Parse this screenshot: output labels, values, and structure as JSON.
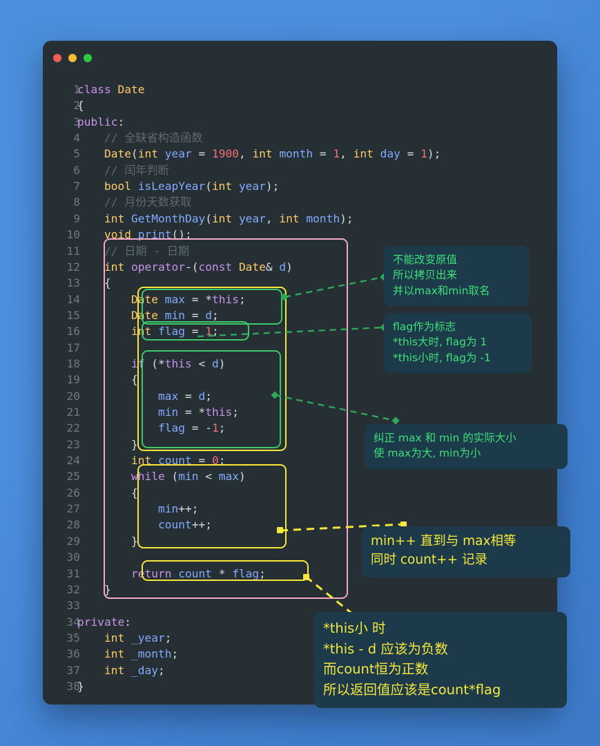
{
  "window": {
    "traffic_lights": [
      "close-red",
      "minimize-yellow",
      "maximize-green"
    ],
    "colors": {
      "background": "#262f33",
      "page_background": "#4a8fdc",
      "pink_box": "#f7a8c4",
      "yellow_box": "#f5e73c",
      "green_box": "#3ec96a",
      "callout_bg": "#1c3a4a",
      "green_text": "#3ee07a",
      "yellow_text": "#f5e73c"
    }
  },
  "code": {
    "language": "cpp",
    "lines": [
      {
        "n": "1",
        "text": "class Date"
      },
      {
        "n": "2",
        "text": "{"
      },
      {
        "n": "3",
        "text": "public:"
      },
      {
        "n": "4",
        "text": "    // 全缺省构造函数"
      },
      {
        "n": "5",
        "text": "    Date(int year = 1900, int month = 1, int day = 1);"
      },
      {
        "n": "6",
        "text": "    // 闰年判断"
      },
      {
        "n": "7",
        "text": "    bool isLeapYear(int year);"
      },
      {
        "n": "8",
        "text": "    // 月份天数获取"
      },
      {
        "n": "9",
        "text": "    int GetMonthDay(int year, int month);"
      },
      {
        "n": "10",
        "text": "    void print();"
      },
      {
        "n": "11",
        "text": "    // 日期 - 日期"
      },
      {
        "n": "12",
        "text": "    int operator-(const Date& d)"
      },
      {
        "n": "13",
        "text": "    {"
      },
      {
        "n": "14",
        "text": "        Date max = *this;"
      },
      {
        "n": "15",
        "text": "        Date min = d;"
      },
      {
        "n": "16",
        "text": "        int flag = 1;"
      },
      {
        "n": "17",
        "text": ""
      },
      {
        "n": "18",
        "text": "        if (*this < d)"
      },
      {
        "n": "19",
        "text": "        {"
      },
      {
        "n": "20",
        "text": "            max = d;"
      },
      {
        "n": "21",
        "text": "            min = *this;"
      },
      {
        "n": "22",
        "text": "            flag = -1;"
      },
      {
        "n": "23",
        "text": "        }"
      },
      {
        "n": "24",
        "text": "        int count = 0;"
      },
      {
        "n": "25",
        "text": "        while (min < max)"
      },
      {
        "n": "26",
        "text": "        {"
      },
      {
        "n": "27",
        "text": "            min++;"
      },
      {
        "n": "28",
        "text": "            count++;"
      },
      {
        "n": "29",
        "text": "        }"
      },
      {
        "n": "30",
        "text": ""
      },
      {
        "n": "31",
        "text": "        return count * flag;"
      },
      {
        "n": "32",
        "text": "    }"
      },
      {
        "n": "33",
        "text": ""
      },
      {
        "n": "34",
        "text": "private:"
      },
      {
        "n": "35",
        "text": "    int _year;"
      },
      {
        "n": "36",
        "text": "    int _month;"
      },
      {
        "n": "37",
        "text": "    int _day;"
      },
      {
        "n": "38",
        "text": "}"
      }
    ]
  },
  "callouts": [
    {
      "id": "copy-note",
      "color": "green",
      "lines": [
        "不能改变原值",
        "所以拷贝出来",
        "并以max和min取名"
      ]
    },
    {
      "id": "flag-note",
      "color": "green",
      "lines": [
        "flag作为标志",
        "*this大时, flag为 1",
        "*this小时, flag为 -1"
      ]
    },
    {
      "id": "minmax-note",
      "color": "green",
      "lines": [
        "纠正 max 和 min 的实际大小",
        "使 max为大, min为小"
      ]
    },
    {
      "id": "loop-note",
      "color": "yellow",
      "lines": [
        "min++ 直到与 max相等",
        "同时 count++ 记录"
      ]
    },
    {
      "id": "return-note",
      "color": "yellow",
      "lines": [
        "*this小 时",
        "*this - d 应该为负数",
        "而count恒为正数",
        "所以返回值应该是count*flag"
      ]
    }
  ]
}
